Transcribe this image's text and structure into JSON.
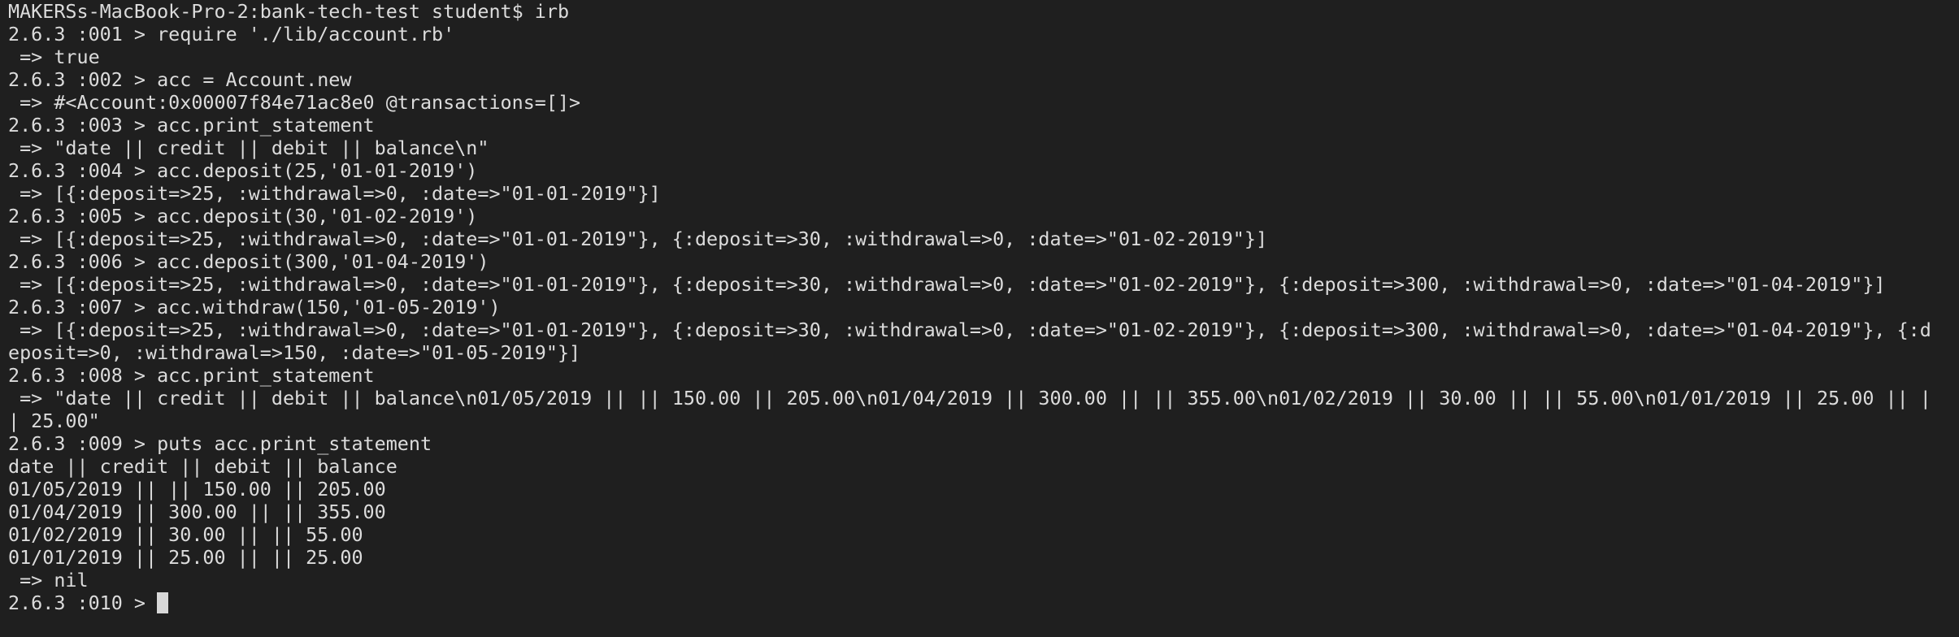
{
  "terminal": {
    "lines": [
      "MAKERSs-MacBook-Pro-2:bank-tech-test student$ irb",
      "2.6.3 :001 > require './lib/account.rb'",
      " => true",
      "2.6.3 :002 > acc = Account.new",
      " => #<Account:0x00007f84e71ac8e0 @transactions=[]>",
      "2.6.3 :003 > acc.print_statement",
      " => \"date || credit || debit || balance\\n\"",
      "2.6.3 :004 > acc.deposit(25,'01-01-2019')",
      " => [{:deposit=>25, :withdrawal=>0, :date=>\"01-01-2019\"}]",
      "2.6.3 :005 > acc.deposit(30,'01-02-2019')",
      " => [{:deposit=>25, :withdrawal=>0, :date=>\"01-01-2019\"}, {:deposit=>30, :withdrawal=>0, :date=>\"01-02-2019\"}]",
      "2.6.3 :006 > acc.deposit(300,'01-04-2019')",
      " => [{:deposit=>25, :withdrawal=>0, :date=>\"01-01-2019\"}, {:deposit=>30, :withdrawal=>0, :date=>\"01-02-2019\"}, {:deposit=>300, :withdrawal=>0, :date=>\"01-04-2019\"}]",
      "2.6.3 :007 > acc.withdraw(150,'01-05-2019')",
      " => [{:deposit=>25, :withdrawal=>0, :date=>\"01-01-2019\"}, {:deposit=>30, :withdrawal=>0, :date=>\"01-02-2019\"}, {:deposit=>300, :withdrawal=>0, :date=>\"01-04-2019\"}, {:d",
      "eposit=>0, :withdrawal=>150, :date=>\"01-05-2019\"}]",
      "2.6.3 :008 > acc.print_statement",
      " => \"date || credit || debit || balance\\n01/05/2019 || || 150.00 || 205.00\\n01/04/2019 || 300.00 || || 355.00\\n01/02/2019 || 30.00 || || 55.00\\n01/01/2019 || 25.00 || |",
      "| 25.00\"",
      "2.6.3 :009 > puts acc.print_statement",
      "date || credit || debit || balance",
      "01/05/2019 || || 150.00 || 205.00",
      "01/04/2019 || 300.00 || || 355.00",
      "01/02/2019 || 30.00 || || 55.00",
      "01/01/2019 || 25.00 || || 25.00",
      " => nil"
    ],
    "prompt": "2.6.3 :010 > "
  }
}
